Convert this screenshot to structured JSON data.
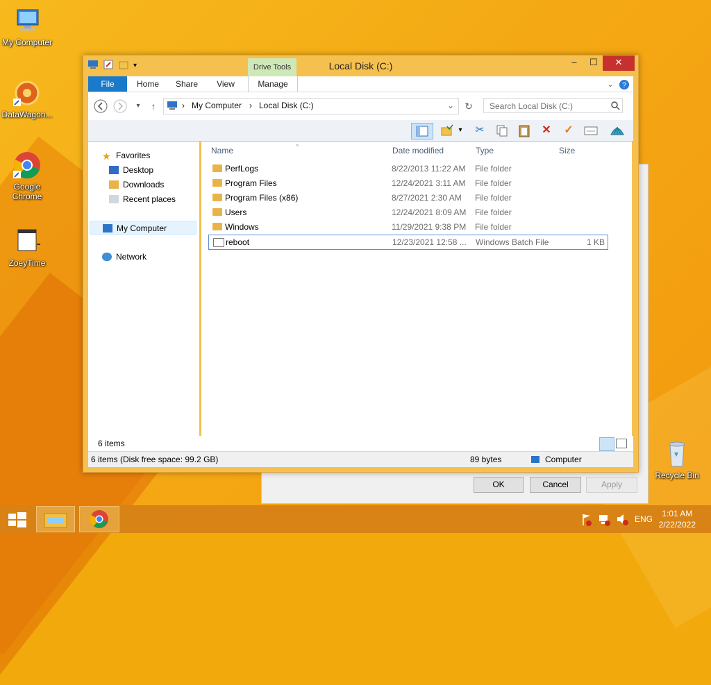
{
  "desktop": {
    "icons": [
      {
        "label": "My Computer"
      },
      {
        "label": "DataWagon..."
      },
      {
        "label": "Google Chrome"
      },
      {
        "label": "ZoeyTime"
      },
      {
        "label": "Recycle Bin"
      }
    ]
  },
  "window": {
    "title": "Local Disk (C:)",
    "context_tab": "Drive Tools",
    "controls": {
      "minimize": "–",
      "maximize": "☐",
      "close": "✕"
    },
    "ribbon_tabs": [
      "File",
      "Home",
      "Share",
      "View",
      "Manage"
    ],
    "address": {
      "crumbs": [
        "My Computer",
        "Local Disk (C:)"
      ]
    },
    "search": {
      "placeholder": "Search Local Disk (C:)"
    },
    "navpane": {
      "favorites": "Favorites",
      "items": [
        "Desktop",
        "Downloads",
        "Recent places"
      ],
      "computer": "My Computer",
      "network": "Network"
    },
    "columns": [
      "Name",
      "Date modified",
      "Type",
      "Size"
    ],
    "files": [
      {
        "name": "PerfLogs",
        "date": "8/22/2013 11:22 AM",
        "type": "File folder",
        "size": ""
      },
      {
        "name": "Program Files",
        "date": "12/24/2021 3:11 AM",
        "type": "File folder",
        "size": ""
      },
      {
        "name": "Program Files (x86)",
        "date": "8/27/2021 2:30 AM",
        "type": "File folder",
        "size": ""
      },
      {
        "name": "Users",
        "date": "12/24/2021 8:09 AM",
        "type": "File folder",
        "size": ""
      },
      {
        "name": "Windows",
        "date": "11/29/2021 9:38 PM",
        "type": "File folder",
        "size": ""
      },
      {
        "name": "reboot",
        "date": "12/23/2021 12:58 ...",
        "type": "Windows Batch File",
        "size": "1 KB"
      }
    ],
    "item_count": "6 items",
    "status": {
      "left": "6 items (Disk free space: 99.2 GB)",
      "middle": "89 bytes",
      "right": "Computer"
    }
  },
  "background_dialog": {
    "ok": "OK",
    "cancel": "Cancel",
    "apply": "Apply"
  },
  "taskbar": {
    "language": "ENG",
    "time": "1:01 AM",
    "date": "2/22/2022"
  },
  "colors": {
    "desktop": "#f4a914",
    "window_frame": "#f5c04e",
    "file_tab": "#1979ca",
    "close_button": "#c7312d",
    "taskbar": "#d88316"
  }
}
